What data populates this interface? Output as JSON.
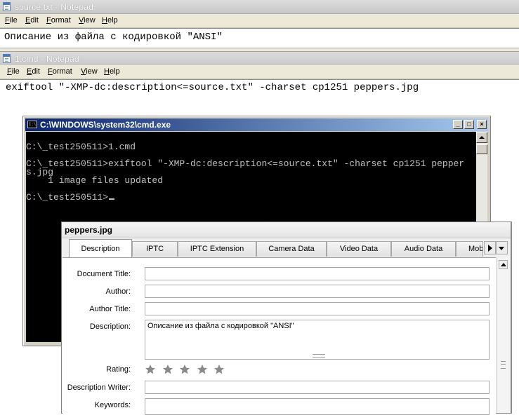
{
  "notepad_source": {
    "title": "source.txt - Notepad",
    "menu": [
      "File",
      "Edit",
      "Format",
      "View",
      "Help"
    ],
    "content": "Описание из файла с кодировкой \"ANSI\""
  },
  "notepad_cmd": {
    "title": "1.cmd - Notepad",
    "menu": [
      "File",
      "Edit",
      "Format",
      "View",
      "Help"
    ],
    "content": "exiftool \"-XMP-dc:description<=source.txt\" -charset cp1251 peppers.jpg"
  },
  "cmd_window": {
    "title": "C:\\WINDOWS\\system32\\cmd.exe",
    "lines": [
      "C:\\_test250511>1.cmd",
      "C:\\_test250511>exiftool \"-XMP-dc:description<=source.txt\" -charset cp1251 pepper",
      "s.jpg",
      "    1 image files updated",
      "C:\\_test250511>"
    ]
  },
  "metadata_panel": {
    "title": "peppers.jpg",
    "tabs": [
      "Description",
      "IPTC",
      "IPTC Extension",
      "Camera Data",
      "Video Data",
      "Audio Data",
      "Mob"
    ],
    "active_tab": "Description",
    "fields": {
      "document_title": {
        "label": "Document Title:",
        "value": ""
      },
      "author": {
        "label": "Author:",
        "value": ""
      },
      "author_title": {
        "label": "Author Title:",
        "value": ""
      },
      "description": {
        "label": "Description:",
        "value": "Описание из файла с кодировкой \"ANSI\""
      },
      "rating": {
        "label": "Rating:",
        "value": 0,
        "max": 5
      },
      "description_writer": {
        "label": "Description Writer:",
        "value": ""
      },
      "keywords": {
        "label": "Keywords:",
        "value": ""
      }
    }
  },
  "colors": {
    "cmd_title_start": "#0a246a",
    "cmd_title_end": "#a6caf0",
    "console_bg": "#000000",
    "console_text": "#c0c0c0",
    "star_empty": "#8a8a8a"
  },
  "icons": {
    "notepad": "notepad-icon",
    "cmd": "cmd-icon",
    "star": "star-icon"
  }
}
